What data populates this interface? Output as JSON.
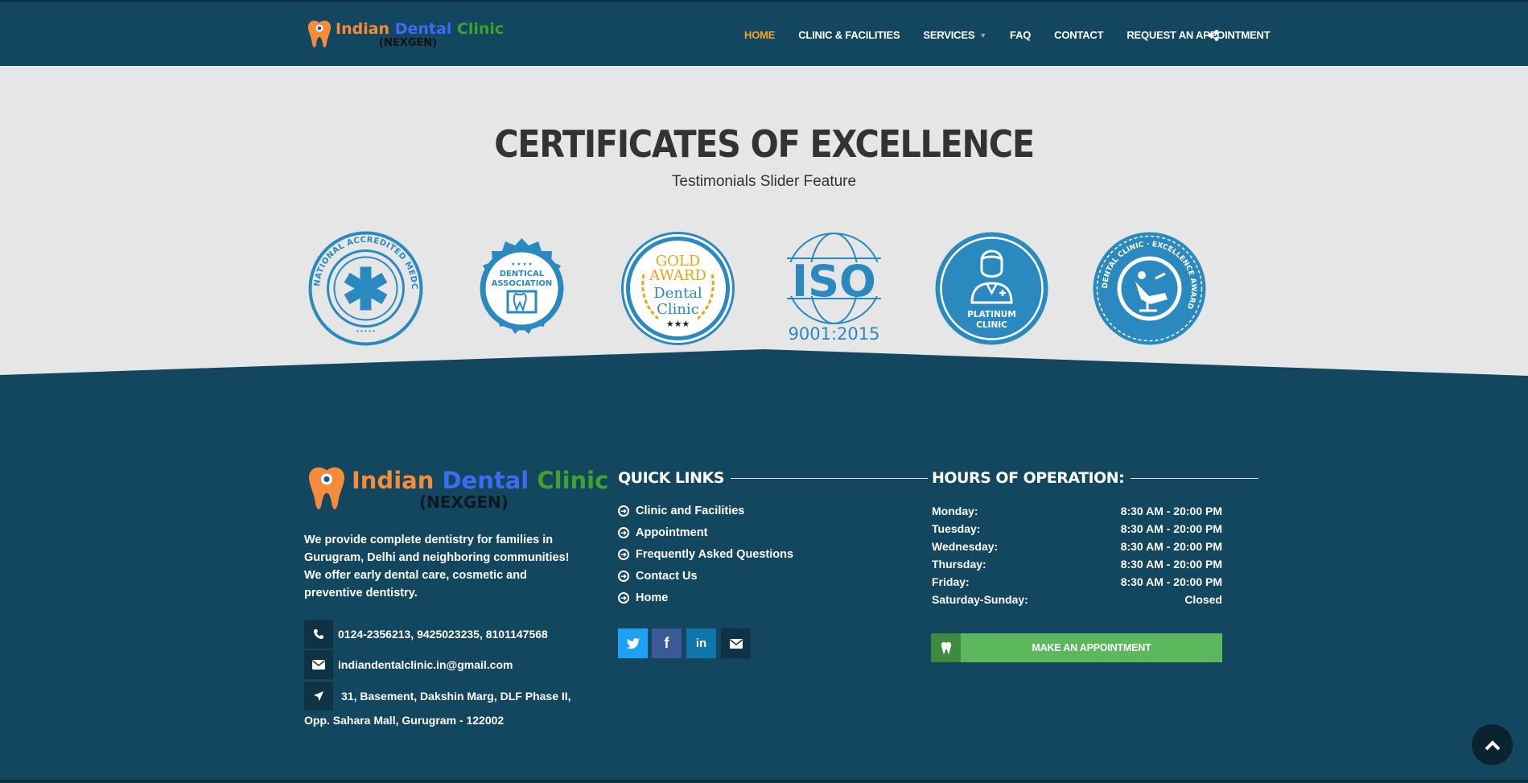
{
  "brand": {
    "word1": "Indian",
    "word2": "Dental",
    "word3": "Clinic",
    "tagline": "(NEXGEN)"
  },
  "nav": {
    "items": [
      {
        "label": "HOME",
        "active": true
      },
      {
        "label": "CLINIC & FACILITIES",
        "active": false
      },
      {
        "label": "SERVICES",
        "active": false,
        "dropdown": true
      },
      {
        "label": "FAQ",
        "active": false
      },
      {
        "label": "CONTACT",
        "active": false
      },
      {
        "label": "REQUEST AN APPOINTMENT",
        "active": false
      }
    ],
    "share_icon": "share-icon"
  },
  "certificates": {
    "title": "CERTIFICATES OF EXCELLENCE",
    "subtitle": "Testimonials Slider Feature",
    "badges": [
      {
        "name": "accredited-medclinic",
        "text_ring": "INTERNATIONAL ACCREDITED MEDCLINIC"
      },
      {
        "name": "dentical-association",
        "line1": "DENTICAL",
        "line2": "ASSOCIATION"
      },
      {
        "name": "gold-award",
        "line1": "GOLD",
        "line2": "AWARD",
        "line3": "Dental",
        "line4": "Clinic",
        "stars": "★★★"
      },
      {
        "name": "iso",
        "line1": "ISO",
        "line2": "9001:2015"
      },
      {
        "name": "platinum-clinic",
        "line1": "PLATINUM",
        "line2": "CLINIC"
      },
      {
        "name": "excellence-award",
        "text_ring": "DENTAL CLINIC · EXCELLENCE AWARD"
      }
    ]
  },
  "footer": {
    "description": "We provide complete dentistry for families in Gurugram, Delhi and neighboring communities! We offer early dental care, cosmetic and preventive dentistry.",
    "phone": "0124-2356213, 9425023235, 8101147568",
    "email": "indiandentalclinic.in@gmail.com",
    "address_line1": "31, Basement, Dakshin Marg, DLF Phase II,",
    "address_line2": "Opp. Sahara Mall, Gurugram - 122002",
    "quick_links_title": "QUICK LINKS",
    "quick_links": [
      "Clinic and Facilities",
      "Appointment",
      "Frequently Asked Questions",
      "Contact Us",
      "Home"
    ],
    "hours_title": "HOURS OF OPERATION:",
    "hours": [
      {
        "day": "Monday:",
        "time": "8:30 AM - 20:00 PM"
      },
      {
        "day": "Tuesday:",
        "time": "8:30 AM - 20:00 PM"
      },
      {
        "day": "Wednesday:",
        "time": "8:30 AM - 20:00 PM"
      },
      {
        "day": "Thursday:",
        "time": "8:30 AM - 20:00 PM"
      },
      {
        "day": "Friday:",
        "time": "8:30 AM - 20:00 PM"
      },
      {
        "day": "Saturday-Sunday:",
        "time": "Closed"
      }
    ],
    "appointment_button": "MAKE AN APPOINTMENT",
    "social": [
      {
        "name": "twitter-icon",
        "glyph": "🐦",
        "color": "#1da1f2"
      },
      {
        "name": "facebook-icon",
        "glyph": "f",
        "color": "#3b5998"
      },
      {
        "name": "linkedin-icon",
        "glyph": "in",
        "color": "#0e76a8"
      },
      {
        "name": "email-icon",
        "glyph": "✉",
        "color": "#0f3344"
      }
    ]
  },
  "colors": {
    "navy": "#13475f",
    "band": "#e6e6e6",
    "accent": "#f5a623",
    "badge_blue": "#2a8ac0",
    "green": "#5cb85c"
  }
}
